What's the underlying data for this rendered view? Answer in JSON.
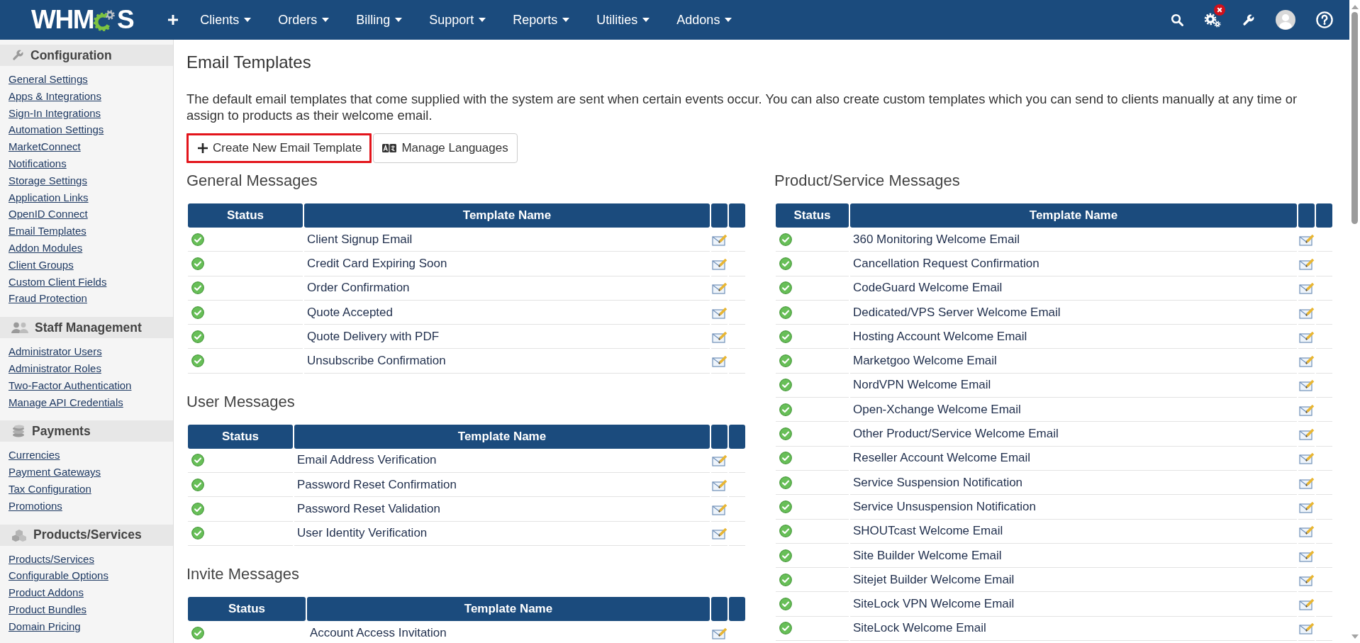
{
  "nav": {
    "logo": {
      "prefix": "WHM",
      "suffix": "S"
    },
    "menus": [
      {
        "label": "Clients"
      },
      {
        "label": "Orders"
      },
      {
        "label": "Billing"
      },
      {
        "label": "Support"
      },
      {
        "label": "Reports"
      },
      {
        "label": "Utilities"
      },
      {
        "label": "Addons"
      }
    ],
    "settings_alert": true
  },
  "sidebar": {
    "sections": [
      {
        "title": "Configuration",
        "links": [
          "General Settings",
          "Apps & Integrations",
          "Sign-In Integrations",
          "Automation Settings",
          "MarketConnect",
          "Notifications",
          "Storage Settings",
          "Application Links",
          "OpenID Connect",
          "Email Templates",
          "Addon Modules",
          "Client Groups",
          "Custom Client Fields",
          "Fraud Protection"
        ]
      },
      {
        "title": "Staff Management",
        "links": [
          "Administrator Users",
          "Administrator Roles",
          "Two-Factor Authentication",
          "Manage API Credentials"
        ]
      },
      {
        "title": "Payments",
        "links": [
          "Currencies",
          "Payment Gateways",
          "Tax Configuration",
          "Promotions"
        ]
      },
      {
        "title": "Products/Services",
        "links": [
          "Products/Services",
          "Configurable Options",
          "Product Addons",
          "Product Bundles",
          "Domain Pricing"
        ]
      }
    ]
  },
  "page": {
    "title": "Email Templates",
    "description": "The default email templates that come supplied with the system are sent when certain events occur. You can also create custom templates which you can send to clients manually at any time or assign to products as their welcome email.",
    "buttons": [
      {
        "label": "Create New Email Template",
        "kind": "create",
        "highlighted": true
      },
      {
        "label": "Manage Languages",
        "kind": "languages",
        "highlighted": false
      }
    ],
    "left_column": [
      {
        "title": "General Messages",
        "columns": [
          "Status",
          "Template Name"
        ],
        "rows": [
          {
            "name": "Client Signup Email",
            "active": true
          },
          {
            "name": "Credit Card Expiring Soon",
            "active": true
          },
          {
            "name": "Order Confirmation",
            "active": true
          },
          {
            "name": "Quote Accepted",
            "active": true
          },
          {
            "name": "Quote Delivery with PDF",
            "active": true
          },
          {
            "name": "Unsubscribe Confirmation",
            "active": true
          }
        ]
      },
      {
        "title": "User Messages",
        "columns": [
          "Status",
          "Template Name"
        ],
        "rows": [
          {
            "name": "Email Address Verification",
            "active": true
          },
          {
            "name": "Password Reset Confirmation",
            "active": true
          },
          {
            "name": "Password Reset Validation",
            "active": true
          },
          {
            "name": "User Identity Verification",
            "active": true
          }
        ]
      },
      {
        "title": "Invite Messages",
        "columns": [
          "Status",
          "Template Name"
        ],
        "rows": [
          {
            "name": "Account Access Invitation",
            "active": true
          }
        ]
      }
    ],
    "right_column": [
      {
        "title": "Product/Service Messages",
        "columns": [
          "Status",
          "Template Name"
        ],
        "rows": [
          {
            "name": "360 Monitoring Welcome Email",
            "active": true
          },
          {
            "name": "Cancellation Request Confirmation",
            "active": true
          },
          {
            "name": "CodeGuard Welcome Email",
            "active": true
          },
          {
            "name": "Dedicated/VPS Server Welcome Email",
            "active": true
          },
          {
            "name": "Hosting Account Welcome Email",
            "active": true
          },
          {
            "name": "Marketgoo Welcome Email",
            "active": true
          },
          {
            "name": "NordVPN Welcome Email",
            "active": true
          },
          {
            "name": "Open-Xchange Welcome Email",
            "active": true
          },
          {
            "name": "Other Product/Service Welcome Email",
            "active": true
          },
          {
            "name": "Reseller Account Welcome Email",
            "active": true
          },
          {
            "name": "Service Suspension Notification",
            "active": true
          },
          {
            "name": "Service Unsuspension Notification",
            "active": true
          },
          {
            "name": "SHOUTcast Welcome Email",
            "active": true
          },
          {
            "name": "Site Builder Welcome Email",
            "active": true
          },
          {
            "name": "Sitejet Builder Welcome Email",
            "active": true
          },
          {
            "name": "SiteLock VPN Welcome Email",
            "active": true
          },
          {
            "name": "SiteLock Welcome Email",
            "active": true
          }
        ]
      }
    ]
  }
}
